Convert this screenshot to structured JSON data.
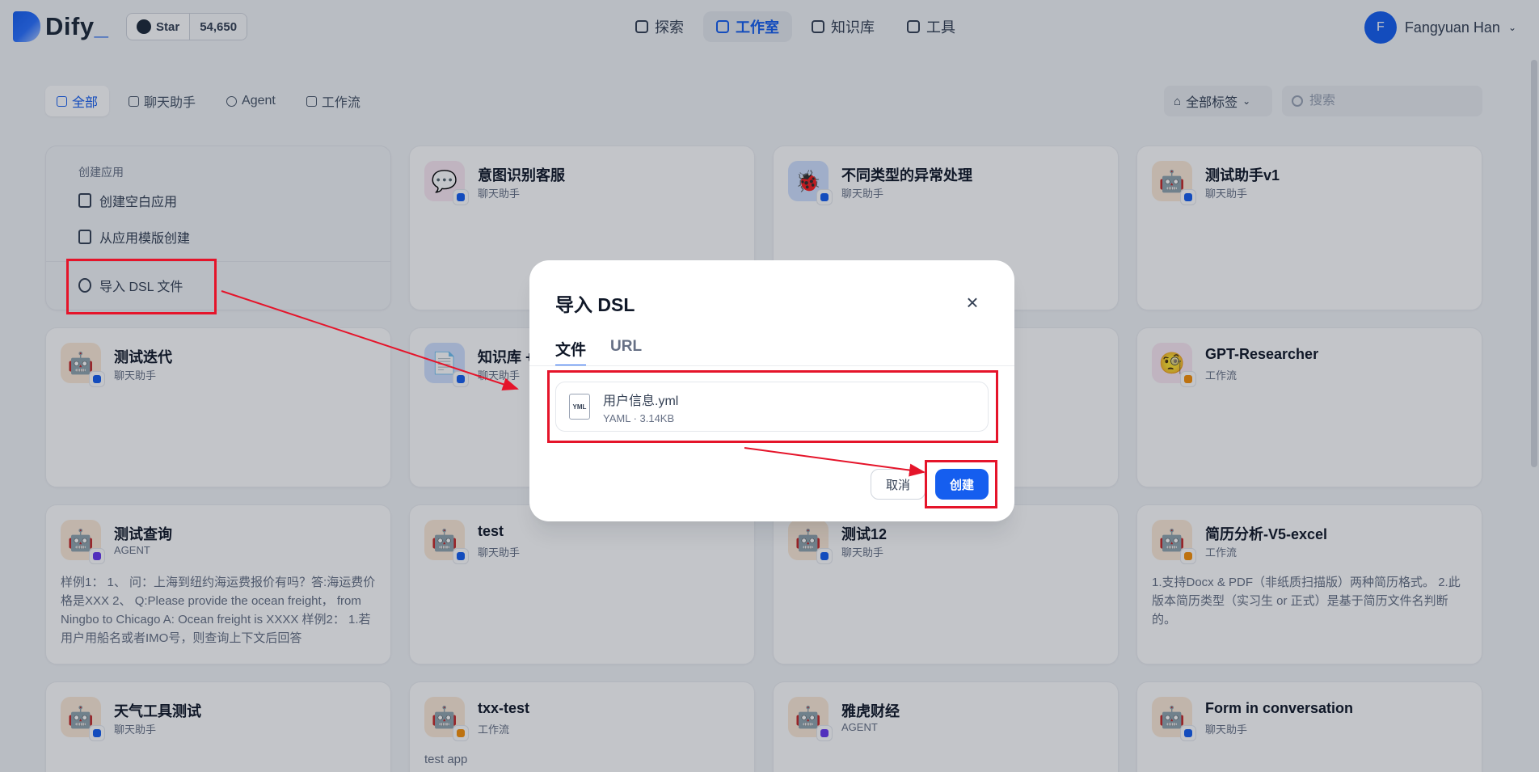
{
  "header": {
    "logo_text": "Dify",
    "logo_underscore": "_",
    "github": {
      "star_label": "Star",
      "star_count": "54,650"
    },
    "nav": [
      {
        "label": "探索",
        "icon": "compass-icon"
      },
      {
        "label": "工作室",
        "icon": "robot-icon",
        "active": true
      },
      {
        "label": "知识库",
        "icon": "book-icon"
      },
      {
        "label": "工具",
        "icon": "hammer-icon"
      }
    ],
    "user": {
      "initial": "F",
      "name": "Fangyuan Han"
    }
  },
  "filters": {
    "tabs": [
      {
        "label": "全部",
        "active": true
      },
      {
        "label": "聊天助手"
      },
      {
        "label": "Agent"
      },
      {
        "label": "工作流"
      }
    ],
    "tag_select": "全部标签",
    "search_placeholder": "搜索"
  },
  "create_card": {
    "title": "创建应用",
    "items": [
      "创建空白应用",
      "从应用模版创建",
      "导入 DSL 文件"
    ]
  },
  "apps": [
    {
      "name": "意图识别客服",
      "type": "聊天助手",
      "icon": "speech-bubble-icon",
      "icon_bg": "#fbe8f3",
      "badge": "chat-badge-icon",
      "badge_color": "#155eef"
    },
    {
      "name": "不同类型的异常处理",
      "type": "聊天助手",
      "icon": "bug-icon",
      "icon_bg": "#d1e0ff",
      "badge": "chat-badge-icon",
      "badge_color": "#155eef"
    },
    {
      "name": "测试助手v1",
      "type": "聊天助手",
      "icon": "robot-face-icon",
      "icon_bg": "#fdead7",
      "badge": "chat-badge-icon",
      "badge_color": "#155eef"
    },
    {
      "name": "测试迭代",
      "type": "聊天助手",
      "icon": "robot-face-icon",
      "icon_bg": "#fdead7",
      "badge": "chat-badge-icon",
      "badge_color": "#155eef"
    },
    {
      "name": "知识库 +",
      "type": "聊天助手",
      "icon": "document-icon",
      "icon_bg": "#d1e0ff",
      "badge": "chat-badge-icon",
      "badge_color": "#155eef"
    },
    {
      "name": "GPT-Researcher",
      "type": "工作流",
      "icon": "face-with-monocle-icon",
      "icon_bg": "#fbe8f3",
      "badge": "workflow-badge-icon",
      "badge_color": "#f79009"
    },
    {
      "name": "测试查询",
      "type": "AGENT",
      "icon": "robot-face-icon",
      "icon_bg": "#fdead7",
      "badge": "agent-badge-icon",
      "badge_color": "#6938ef",
      "desc": "样例1： 1、 问：上海到纽约海运费报价有吗？答:海运费价格是XXX 2、 Q:Please provide the ocean freight， from Ningbo to Chicago A: Ocean freight is XXXX 样例2： 1.若用户用船名或者IMO号，则查询上下文后回答"
    },
    {
      "name": "test",
      "type": "聊天助手",
      "icon": "robot-face-icon",
      "icon_bg": "#fdead7",
      "badge": "chat-badge-icon",
      "badge_color": "#155eef"
    },
    {
      "name": "测试12",
      "type": "聊天助手",
      "icon": "robot-face-icon",
      "icon_bg": "#fdead7",
      "badge": "chat-badge-icon",
      "badge_color": "#155eef"
    },
    {
      "name": "简历分析-V5-excel",
      "type": "工作流",
      "icon": "robot-face-icon",
      "icon_bg": "#fdead7",
      "badge": "workflow-badge-icon",
      "badge_color": "#f79009",
      "desc": "1.支持Docx & PDF（非纸质扫描版）两种简历格式。 2.此版本简历类型（实习生 or 正式）是基于简历文件名判断的。"
    },
    {
      "name": "天气工具测试",
      "type": "聊天助手",
      "icon": "robot-face-icon",
      "icon_bg": "#fdead7",
      "badge": "chat-badge-icon",
      "badge_color": "#155eef"
    },
    {
      "name": "txx-test",
      "type": "工作流",
      "icon": "robot-face-icon",
      "icon_bg": "#fdead7",
      "badge": "workflow-badge-icon",
      "badge_color": "#f79009",
      "desc": "test app"
    },
    {
      "name": "雅虎财经",
      "type": "AGENT",
      "icon": "robot-face-icon",
      "icon_bg": "#fdead7",
      "badge": "agent-badge-icon",
      "badge_color": "#6938ef"
    },
    {
      "name": "Form in conversation",
      "type": "聊天助手",
      "icon": "robot-face-icon",
      "icon_bg": "#fdead7",
      "badge": "chat-badge-icon",
      "badge_color": "#155eef"
    }
  ],
  "modal": {
    "title": "导入 DSL",
    "tabs": [
      "文件",
      "URL"
    ],
    "active_tab": "文件",
    "file": {
      "name": "用户信息.yml",
      "meta": "YAML · 3.14KB",
      "icon_label": "YML"
    },
    "cancel_label": "取消",
    "create_label": "创建"
  },
  "colors": {
    "accent": "#155eef",
    "annotation": "#e5142a",
    "page_bg": "#f2f4f7"
  }
}
